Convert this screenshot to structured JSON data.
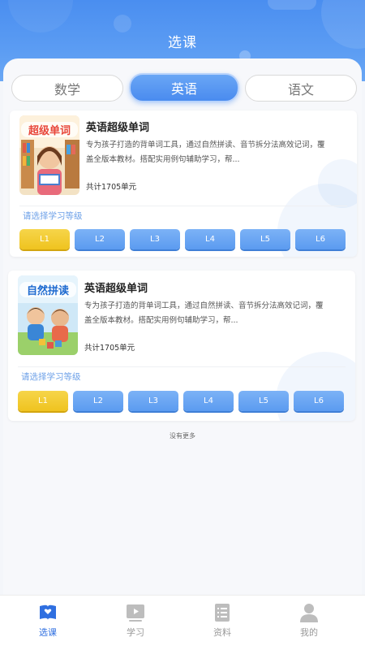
{
  "header": {
    "title": "选课"
  },
  "subject_tabs": [
    {
      "label": "数学",
      "active": false
    },
    {
      "label": "英语",
      "active": true
    },
    {
      "label": "语文",
      "active": false
    }
  ],
  "courses": [
    {
      "cover_label": "超级单词",
      "title": "英语超级单词",
      "description": "专为孩子打造的背单词工具，通过自然拼读、音节拆分法高效记词，覆盖全版本教材。搭配实用例句辅助学习，帮...",
      "count": "共计1705单元",
      "level_prompt": "请选择学习等级",
      "levels": [
        "L1",
        "L2",
        "L3",
        "L4",
        "L5",
        "L6"
      ],
      "selected_level": "L1"
    },
    {
      "cover_label": "自然拼读",
      "title": "英语超级单词",
      "description": "专为孩子打造的背单词工具，通过自然拼读、音节拆分法高效记词，覆盖全版本教材。搭配实用例句辅助学习，帮...",
      "count": "共计1705单元",
      "level_prompt": "请选择学习等级",
      "levels": [
        "L1",
        "L2",
        "L3",
        "L4",
        "L5",
        "L6"
      ],
      "selected_level": "L1"
    }
  ],
  "no_more_text": "没有更多",
  "tabbar": [
    {
      "label": "选课",
      "icon": "heart-book-icon",
      "active": true
    },
    {
      "label": "学习",
      "icon": "play-icon",
      "active": false
    },
    {
      "label": "资料",
      "icon": "document-list-icon",
      "active": false
    },
    {
      "label": "我的",
      "icon": "user-icon",
      "active": false
    }
  ],
  "colors": {
    "primary": "#4a8bef",
    "active_level": "#efc31f",
    "level": "#5b9bf0"
  }
}
